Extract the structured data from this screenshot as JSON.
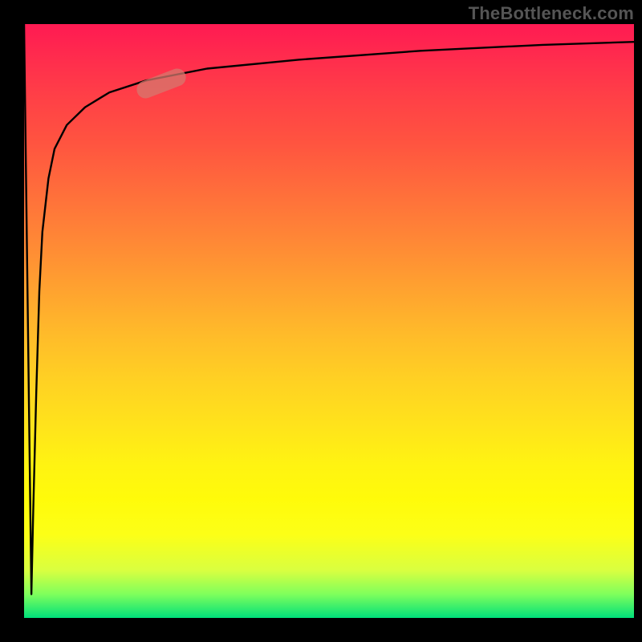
{
  "watermark": {
    "text": "TheBottleneck.com"
  },
  "colors": {
    "frame": "#000000",
    "curve": "#000000",
    "highlight": "rgba(214,120,110,0.75)",
    "gradient_top": "#ff1a52",
    "gradient_mid": "#fff312",
    "gradient_bottom": "#00e07a"
  },
  "chart_data": {
    "type": "line",
    "title": "",
    "xlabel": "",
    "ylabel": "",
    "xlim": [
      0,
      100
    ],
    "ylim": [
      0,
      100
    ],
    "grid": false,
    "legend": false,
    "annotations": [
      {
        "label": "TheBottleneck.com",
        "role": "watermark"
      }
    ],
    "series": [
      {
        "name": "curve",
        "x": [
          0,
          0.5,
          1.0,
          1.2,
          1.5,
          2.0,
          2.5,
          3.0,
          4.0,
          5.0,
          7.0,
          10.0,
          14.0,
          20.0,
          30.0,
          45.0,
          65.0,
          85.0,
          100.0
        ],
        "y": [
          100,
          60,
          20,
          4,
          18,
          38,
          55,
          65,
          74,
          79,
          83,
          86,
          88.5,
          90.5,
          92.5,
          94.0,
          95.5,
          96.5,
          97.0
        ]
      }
    ],
    "highlight": {
      "x_range": [
        18,
        27
      ],
      "y_range": [
        88,
        92
      ],
      "shape": "pill"
    },
    "background": {
      "type": "vertical-gradient",
      "stops": [
        {
          "pos": 0.0,
          "color": "#ff1a52"
        },
        {
          "pos": 0.5,
          "color": "#ffba2a"
        },
        {
          "pos": 0.8,
          "color": "#fffb0a"
        },
        {
          "pos": 1.0,
          "color": "#00e07a"
        }
      ]
    }
  }
}
